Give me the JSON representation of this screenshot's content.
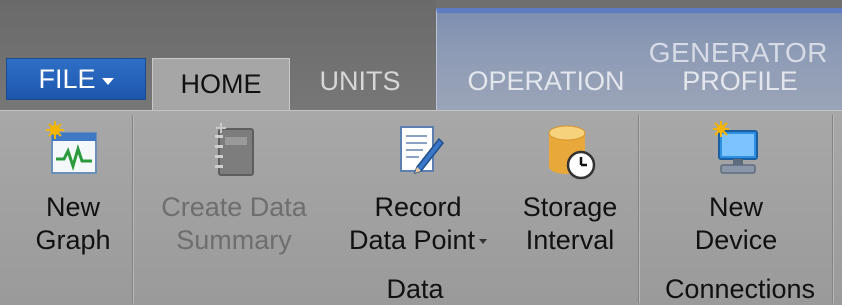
{
  "ribbon": {
    "file_tab": "FILE",
    "tabs": [
      {
        "label": "HOME",
        "active": true
      },
      {
        "label": "UNITS",
        "active": false
      },
      {
        "label": "OPERATION",
        "active": false
      },
      {
        "label": "PROFILE",
        "active": false
      }
    ],
    "contextual_group": "GENERATOR",
    "buttons": {
      "new_graph": [
        "New",
        "Graph"
      ],
      "create_summary": [
        "Create Data",
        "Summary"
      ],
      "record_point": [
        "Record",
        "Data Point"
      ],
      "storage_interval": [
        "Storage",
        "Interval"
      ],
      "new_device": [
        "New",
        "Device"
      ]
    },
    "groups": {
      "data": "Data",
      "connections": "Connections"
    },
    "icons": {
      "new_graph": "graph-sparkle-icon",
      "create_summary": "notebook-icon",
      "record_point": "pencil-document-icon",
      "storage_interval": "database-clock-icon",
      "new_device": "monitor-sparkle-icon"
    },
    "colors": {
      "file_tab": "#1d57ad",
      "contextual_accent": "#5f7bc4",
      "ribbon_bg": "#a8a8a8"
    }
  }
}
